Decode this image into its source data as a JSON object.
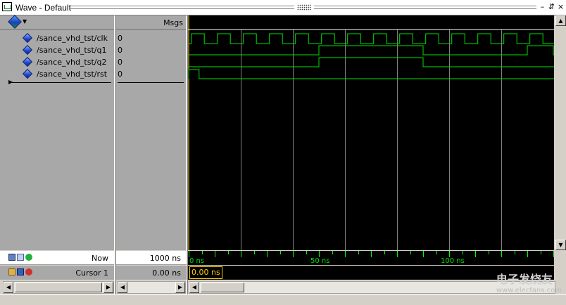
{
  "window": {
    "title": "Wave - Default",
    "min_glyph": "–",
    "restore_glyph": "⇵",
    "close_glyph": "×"
  },
  "header": {
    "msgs_label": "Msgs"
  },
  "signals": [
    {
      "name": "/sance_vhd_tst/clk",
      "value": "0"
    },
    {
      "name": "/sance_vhd_tst/q1",
      "value": "0"
    },
    {
      "name": "/sance_vhd_tst/q2",
      "value": "0"
    },
    {
      "name": "/sance_vhd_tst/rst",
      "value": "0"
    }
  ],
  "footer": {
    "now_label": "Now",
    "now_value": "1000 ns",
    "cursor_label": "Cursor 1",
    "cursor_value": "0.00 ns",
    "cursor_marker": "0.00 ns"
  },
  "timeline": {
    "labels": [
      "0 ns",
      "50 ns",
      "100 ns"
    ],
    "view_ns": [
      0,
      140
    ],
    "label_ns": [
      0,
      50,
      100
    ]
  },
  "waveforms": {
    "unit": "ns",
    "clk_period": 10,
    "clk_first_rise": 1,
    "q1_high": [
      [
        50,
        90
      ],
      [
        130,
        140
      ]
    ],
    "q2_high": [
      [
        50,
        90
      ]
    ],
    "rst_high": [
      [
        0,
        4
      ]
    ]
  },
  "watermark": {
    "main": "电子发烧友",
    "sub": "www.elecfans.com"
  },
  "colors": {
    "wave": "#00e000",
    "cursor": "#ffd000",
    "grid": "#808080"
  }
}
